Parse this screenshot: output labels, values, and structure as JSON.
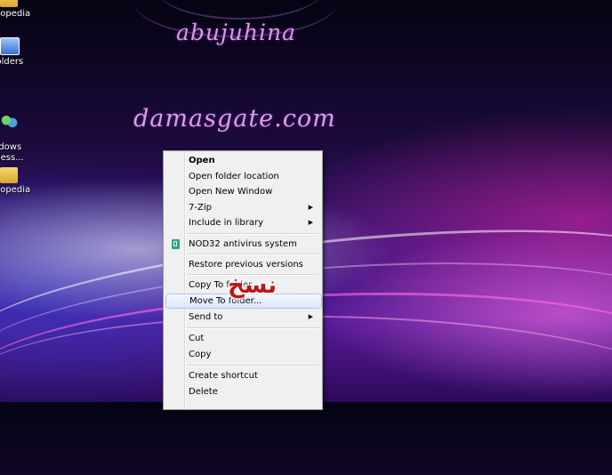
{
  "desktop": {
    "icons": [
      {
        "label": "clopedia",
        "icon": "folder-icon"
      },
      {
        "label": "folders",
        "icon": "network-folder-icon"
      },
      {
        "label": "ndows\nMess...",
        "icon": "messenger-icon"
      },
      {
        "label": "clopedia",
        "icon": "folder-icon"
      }
    ],
    "watermarks": [
      "abujuhina",
      "damasgate.com"
    ]
  },
  "context_menu": {
    "items": [
      {
        "label": "Open",
        "bold": true
      },
      {
        "label": "Open folder location"
      },
      {
        "label": "Open New Window"
      },
      {
        "label": "7-Zip",
        "submenu": true
      },
      {
        "label": "Include in library",
        "submenu": true
      },
      {
        "label": "NOD32 antivirus system",
        "icon": "nod32-icon"
      },
      {
        "label": "Restore previous versions"
      },
      {
        "label": "Copy To folder..."
      },
      {
        "label": "Move To folder...",
        "highlighted": true
      },
      {
        "label": "Send to",
        "submenu": true
      },
      {
        "label": "Cut"
      },
      {
        "label": "Copy"
      },
      {
        "label": "Create shortcut"
      },
      {
        "label": "Delete"
      }
    ],
    "submenu_arrow": "▶"
  },
  "overlay": {
    "arabic_text": "نسخ"
  },
  "colors": {
    "menu_bg": "#f0f0f0",
    "highlight": "#dde9fb",
    "highlight_border": "#a8c8ef",
    "watermark": "#d99ae8",
    "arabic": "#c11414"
  }
}
